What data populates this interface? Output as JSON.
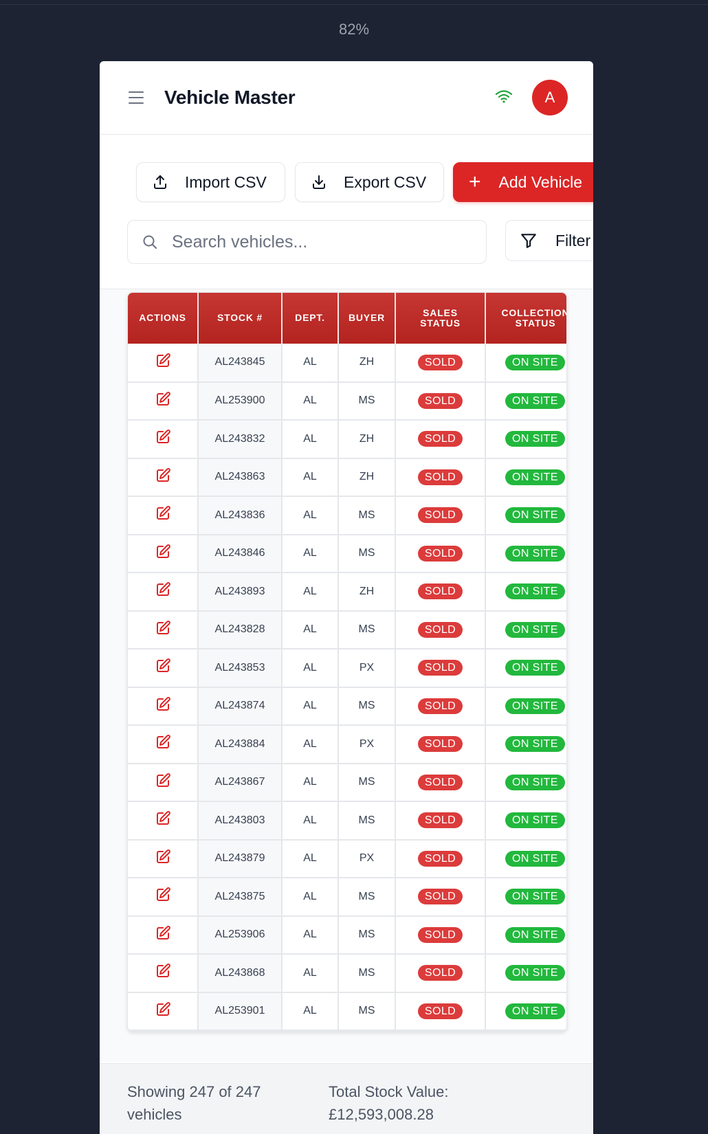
{
  "browser": {
    "zoom": "82%"
  },
  "header": {
    "title": "Vehicle Master",
    "avatar_initial": "A",
    "wifi_icon": "wifi-icon",
    "menu_icon": "hamburger-icon"
  },
  "toolbar": {
    "import_label": "Import CSV",
    "export_label": "Export CSV",
    "add_label": "Add Vehicle",
    "search_placeholder": "Search vehicles...",
    "filter_label": "Filter"
  },
  "table": {
    "columns": [
      "ACTIONS",
      "STOCK #",
      "DEPT.",
      "BUYER",
      "SALES STATUS",
      "COLLECTION STATUS"
    ],
    "rows": [
      {
        "stock": "AL243845",
        "dept": "AL",
        "buyer": "ZH",
        "sales": "SOLD",
        "collection": "ON SITE"
      },
      {
        "stock": "AL253900",
        "dept": "AL",
        "buyer": "MS",
        "sales": "SOLD",
        "collection": "ON SITE"
      },
      {
        "stock": "AL243832",
        "dept": "AL",
        "buyer": "ZH",
        "sales": "SOLD",
        "collection": "ON SITE"
      },
      {
        "stock": "AL243863",
        "dept": "AL",
        "buyer": "ZH",
        "sales": "SOLD",
        "collection": "ON SITE"
      },
      {
        "stock": "AL243836",
        "dept": "AL",
        "buyer": "MS",
        "sales": "SOLD",
        "collection": "ON SITE"
      },
      {
        "stock": "AL243846",
        "dept": "AL",
        "buyer": "MS",
        "sales": "SOLD",
        "collection": "ON SITE"
      },
      {
        "stock": "AL243893",
        "dept": "AL",
        "buyer": "ZH",
        "sales": "SOLD",
        "collection": "ON SITE"
      },
      {
        "stock": "AL243828",
        "dept": "AL",
        "buyer": "MS",
        "sales": "SOLD",
        "collection": "ON SITE"
      },
      {
        "stock": "AL243853",
        "dept": "AL",
        "buyer": "PX",
        "sales": "SOLD",
        "collection": "ON SITE"
      },
      {
        "stock": "AL243874",
        "dept": "AL",
        "buyer": "MS",
        "sales": "SOLD",
        "collection": "ON SITE"
      },
      {
        "stock": "AL243884",
        "dept": "AL",
        "buyer": "PX",
        "sales": "SOLD",
        "collection": "ON SITE"
      },
      {
        "stock": "AL243867",
        "dept": "AL",
        "buyer": "MS",
        "sales": "SOLD",
        "collection": "ON SITE"
      },
      {
        "stock": "AL243803",
        "dept": "AL",
        "buyer": "MS",
        "sales": "SOLD",
        "collection": "ON SITE"
      },
      {
        "stock": "AL243879",
        "dept": "AL",
        "buyer": "PX",
        "sales": "SOLD",
        "collection": "ON SITE"
      },
      {
        "stock": "AL243875",
        "dept": "AL",
        "buyer": "MS",
        "sales": "SOLD",
        "collection": "ON SITE"
      },
      {
        "stock": "AL253906",
        "dept": "AL",
        "buyer": "MS",
        "sales": "SOLD",
        "collection": "ON SITE"
      },
      {
        "stock": "AL243868",
        "dept": "AL",
        "buyer": "MS",
        "sales": "SOLD",
        "collection": "ON SITE"
      },
      {
        "stock": "AL253901",
        "dept": "AL",
        "buyer": "MS",
        "sales": "SOLD",
        "collection": "ON SITE"
      }
    ]
  },
  "footer": {
    "showing": "Showing 247 of 247 vehicles",
    "total_value": "Total Stock Value: £12,593,008.28"
  },
  "colors": {
    "brand": "#dc2626",
    "sold": "#dc3b3b",
    "on_site": "#22b83d",
    "background": "#1e2333"
  }
}
